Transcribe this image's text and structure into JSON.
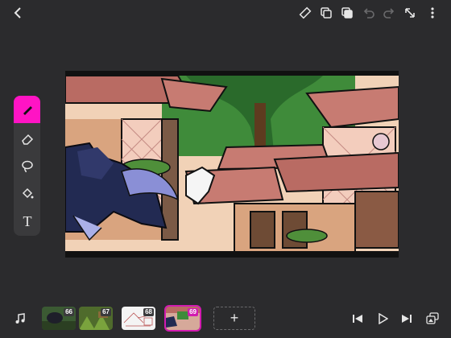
{
  "colors": {
    "background": "#2b2b2d",
    "panel": "#3a3a3c",
    "accent": "#ff14c4",
    "active_frame": "#d21bb0"
  },
  "toolbar_top": {
    "icons": [
      "back-icon",
      "ruler-icon",
      "duplicate-icon",
      "layers-icon",
      "undo-icon",
      "redo-icon",
      "expand-icon",
      "more-icon"
    ]
  },
  "left_tools": {
    "current_color": "#ff14c4",
    "tools": [
      "pen-icon",
      "eraser-icon",
      "lasso-icon",
      "fill-bucket-icon",
      "text-icon"
    ],
    "text_tool_glyph": "T"
  },
  "timeline": {
    "frames": [
      {
        "number": "66",
        "active": false
      },
      {
        "number": "67",
        "active": false
      },
      {
        "number": "68",
        "active": false
      },
      {
        "number": "69",
        "active": true
      }
    ],
    "add_label": "+"
  },
  "playback": {
    "icons": [
      "music-icon",
      "skip-back-icon",
      "play-icon",
      "skip-forward-icon",
      "onion-skin-icon"
    ]
  }
}
